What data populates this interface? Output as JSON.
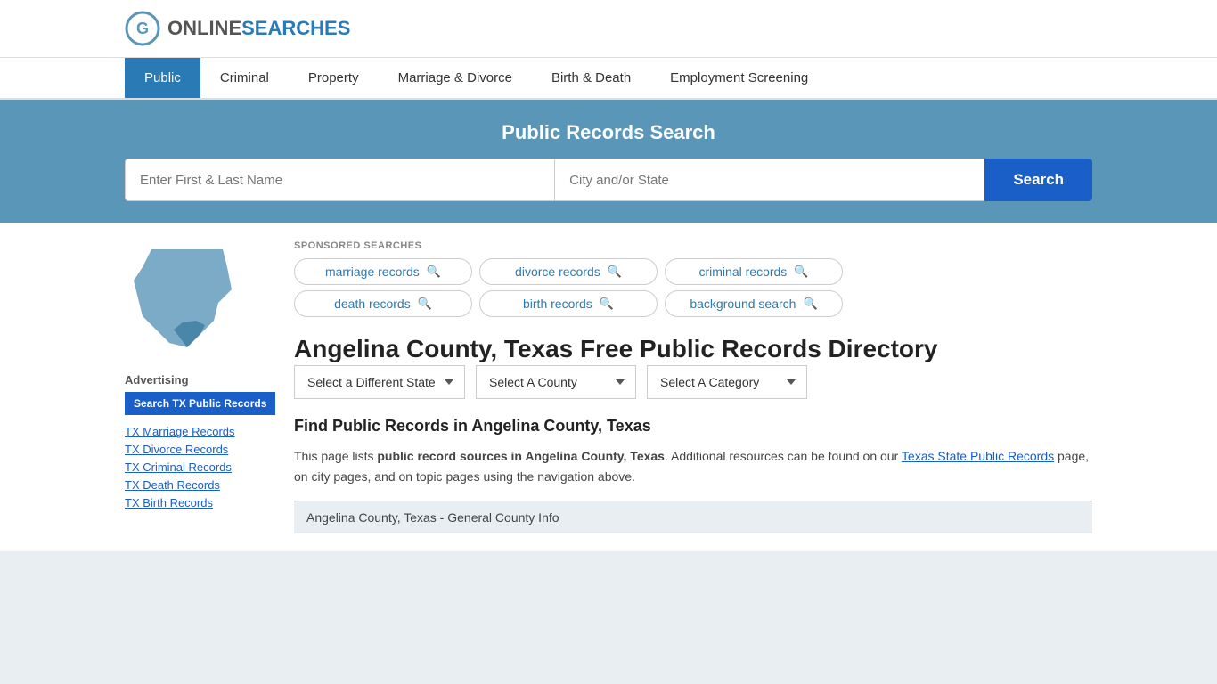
{
  "header": {
    "logo_text_online": "ONLINE",
    "logo_text_searches": "SEARCHES"
  },
  "nav": {
    "items": [
      {
        "label": "Public",
        "active": true
      },
      {
        "label": "Criminal",
        "active": false
      },
      {
        "label": "Property",
        "active": false
      },
      {
        "label": "Marriage & Divorce",
        "active": false
      },
      {
        "label": "Birth & Death",
        "active": false
      },
      {
        "label": "Employment Screening",
        "active": false
      }
    ]
  },
  "search_banner": {
    "title": "Public Records Search",
    "name_placeholder": "Enter First & Last Name",
    "city_placeholder": "City and/or State",
    "button_label": "Search"
  },
  "sponsored": {
    "label": "SPONSORED SEARCHES",
    "tags": [
      {
        "text": "marriage records"
      },
      {
        "text": "divorce records"
      },
      {
        "text": "criminal records"
      },
      {
        "text": "death records"
      },
      {
        "text": "birth records"
      },
      {
        "text": "background search"
      }
    ]
  },
  "page": {
    "title": "Angelina County, Texas Free Public Records Directory",
    "dropdowns": {
      "state": "Select a Different State",
      "county": "Select A County",
      "category": "Select A Category"
    },
    "find_title": "Find Public Records in Angelina County, Texas",
    "find_text_1": "This page lists ",
    "find_bold_1": "public record sources in Angelina County, Texas",
    "find_text_2": ". Additional resources can be found on our ",
    "find_link": "Texas State Public Records",
    "find_text_3": " page, on city pages, and on topic pages using the navigation above.",
    "general_info_bar": "Angelina County, Texas - General County Info"
  },
  "sidebar": {
    "advertising_label": "Advertising",
    "ad_button": "Search TX Public Records",
    "links": [
      {
        "label": "TX Marriage Records"
      },
      {
        "label": "TX Divorce Records"
      },
      {
        "label": "TX Criminal Records"
      },
      {
        "label": "TX Death Records"
      },
      {
        "label": "TX Birth Records"
      }
    ]
  }
}
